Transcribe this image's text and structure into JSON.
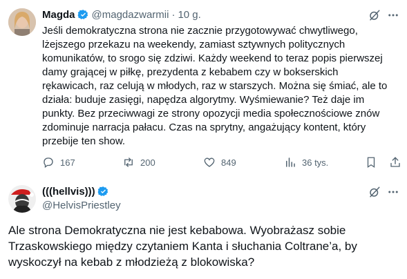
{
  "tweet": {
    "author_name": "Magda",
    "handle": "@magdazwarmii",
    "separator": "·",
    "time": "10 g.",
    "text": "Jeśli demokratyczna strona nie zacznie przygotowywać chwytliwego,\nlżejszego przekazu na weekendy, zamiast sztywnych politycznych\nkomunikatów, to srogo się zdziwi. Każdy weekend to teraz popis pierwszej\ndamy grającej w piłkę, prezydenta z kebabem czy w bokserskich\nrękawicach, raz celują w młodych, raz w starszych. Można się śmiać, ale to\ndziała: buduje zasięgi, napędza algorytmy. Wyśmiewanie? Też daje im\npunkty. Bez przeciwwagi ze strony opozycji media społecznościowe znów\nzdominuje narracja pałacu. Czas na sprytny, angażujący kontent, który\nprzebije ten show.",
    "actions": {
      "replies": "167",
      "reposts": "200",
      "likes": "849",
      "views": "36 tys."
    }
  },
  "reply": {
    "author_name": "(((hellvis)))",
    "handle": "@HelvisPriestley",
    "text": "Ale strona Demokratyczna nie jest kebabowa. Wyobrażasz sobie\nTrzaskowskiego między czytaniem Kanta i słuchania Coltrane’a, by\nwyskoczył na kebab z młodzieżą z blokowiska?"
  },
  "colors": {
    "verified": "#1d9bf0",
    "muted": "#536471",
    "text": "#0f1419"
  },
  "icons": [
    "verified-badge-icon",
    "grok-icon",
    "more-icon",
    "reply-icon",
    "repost-icon",
    "like-icon",
    "views-icon",
    "bookmark-icon",
    "share-icon"
  ]
}
